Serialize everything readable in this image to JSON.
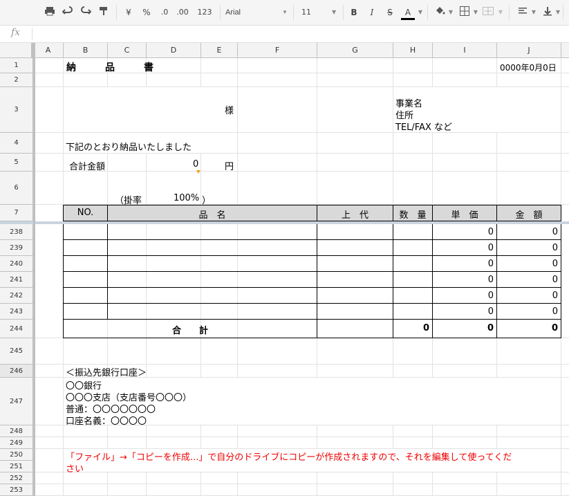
{
  "toolbar": {
    "percent": "%",
    "dec_less": ".0",
    "dec_more": ".00",
    "format_more": "123",
    "font": "Arial",
    "size": "11",
    "bold": "B",
    "italic": "I",
    "strike": "S",
    "textcolor": "A",
    "currency": "¥"
  },
  "formula_bar": {
    "fx": "fx",
    "value": ""
  },
  "columns": [
    "A",
    "B",
    "C",
    "D",
    "E",
    "F",
    "G",
    "H",
    "I",
    "J"
  ],
  "rows": [
    "1",
    "2",
    "3",
    "4",
    "5",
    "6",
    "7",
    "238",
    "239",
    "240",
    "241",
    "242",
    "243",
    "244",
    "245",
    "246",
    "247",
    "248",
    "249",
    "250",
    "251",
    "252",
    "253"
  ],
  "sheet": {
    "title": "納　　　品　　　書",
    "date": "0000年0月0日",
    "sama": "様",
    "company_lines": [
      "事業名",
      "住所",
      "TEL/FAX など"
    ],
    "notice": "下記のとおり納品いたしました",
    "total_label": "合計金額",
    "total_value": "0",
    "yen": "円",
    "rate_label": "（掛率",
    "rate_value": "100%",
    "rate_close": "）",
    "headers": {
      "no": "NO.",
      "item": "品　名",
      "retail": "上　代",
      "qty": "数　量",
      "unit": "単　価",
      "amount": "金　額"
    },
    "item_rows": [
      {
        "unit": "0",
        "amount": "0"
      },
      {
        "unit": "0",
        "amount": "0"
      },
      {
        "unit": "0",
        "amount": "0"
      },
      {
        "unit": "0",
        "amount": "0"
      },
      {
        "unit": "0",
        "amount": "0"
      },
      {
        "unit": "0",
        "amount": "0"
      }
    ],
    "sum_label": "合　　計",
    "sum_qty": "0",
    "sum_unit": "0",
    "sum_amount": "0",
    "bank_title": "＜振込先銀行口座＞",
    "bank_lines": [
      "〇〇銀行",
      "〇〇〇支店（支店番号〇〇〇）",
      "普通：〇〇〇〇〇〇〇",
      "口座名義：〇〇〇〇"
    ],
    "instruction_1": "「ファイル」→「コピーを作成...」で自分のドライブにコピーが作成されますので、それを編集して使ってくだ",
    "instruction_2": "さい"
  }
}
